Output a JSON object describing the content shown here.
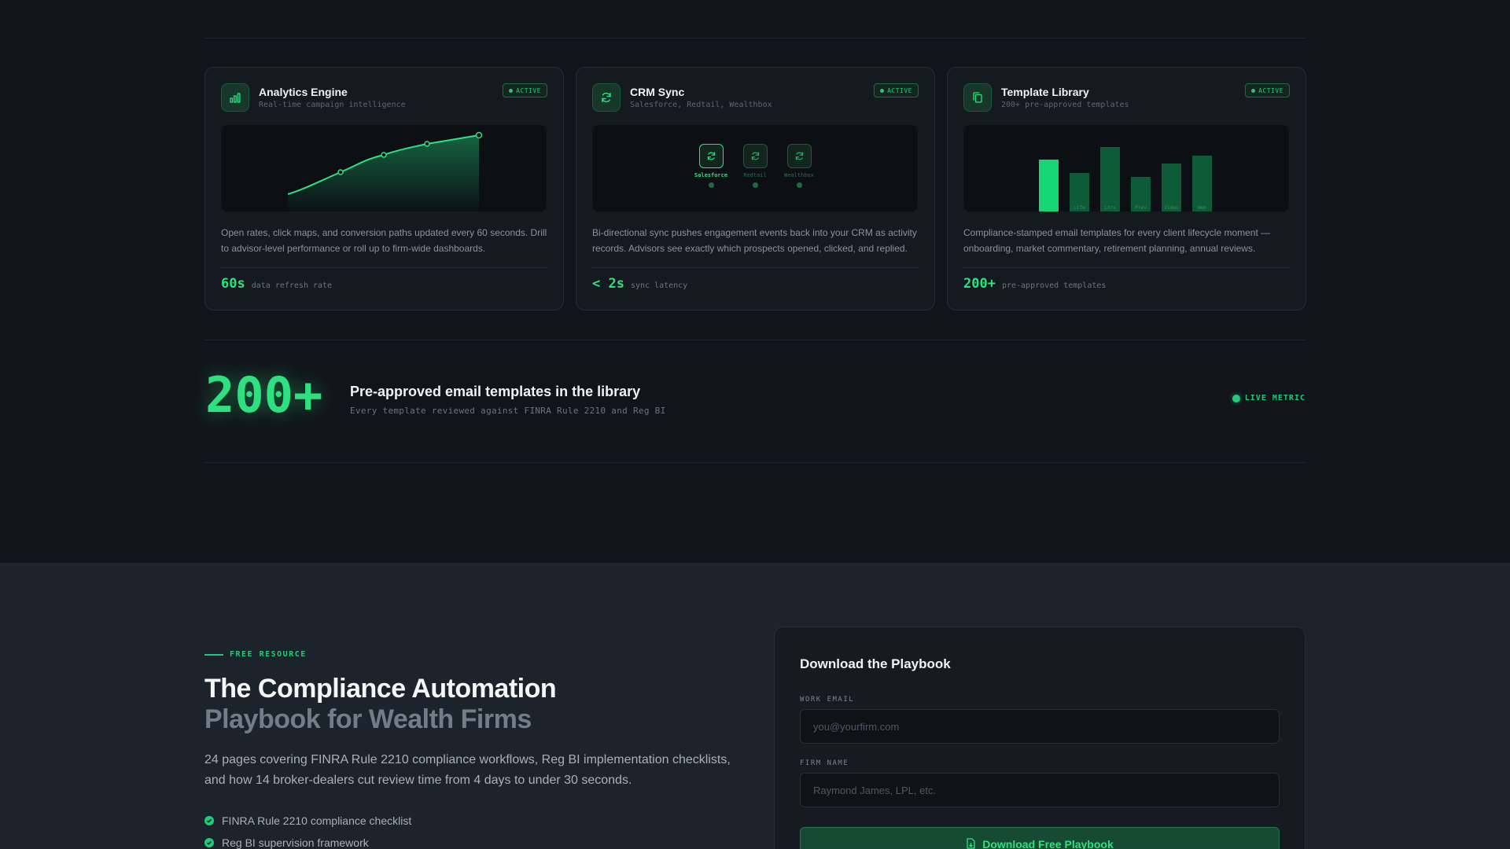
{
  "cards": [
    {
      "title": "Analytics Engine",
      "subtitle": "Real-time campaign intelligence",
      "badge": "ACTIVE",
      "icon": "bar-chart-icon",
      "description": "Open rates, click maps, and conversion paths updated every 60 seconds. Drill to advisor-level performance or roll up to firm-wide dashboards.",
      "stat_value": "60s",
      "stat_label": "data refresh rate"
    },
    {
      "title": "CRM Sync",
      "subtitle": "Salesforce, Redtail, Wealthbox",
      "badge": "ACTIVE",
      "icon": "refresh-icon",
      "description": "Bi-directional sync pushes engagement events back into your CRM as activity records. Advisors see exactly which prospects opened, clicked, and replied.",
      "stat_value": "< 2s",
      "stat_label": "sync latency",
      "integrations": [
        "Salesforce",
        "Redtail",
        "Wealthbox"
      ]
    },
    {
      "title": "Template Library",
      "subtitle": "200+ pre-approved templates",
      "badge": "ACTIVE",
      "icon": "copy-icon",
      "description": "Compliance-stamped email templates for every client lifecycle moment — onboarding, market commentary, retirement planning, annual reviews.",
      "stat_value": "200+",
      "stat_label": "pre-approved templates",
      "bar_labels": [
        "",
        "Life",
        "Ltrs",
        "Prev",
        "Video",
        "Web"
      ]
    }
  ],
  "metric": {
    "value": "200+",
    "title": "Pre-approved email templates in the library",
    "subtitle": "Every template reviewed against FINRA Rule 2210 and Reg BI",
    "live_label": "LIVE METRIC"
  },
  "resource": {
    "eyebrow": "FREE RESOURCE",
    "title_line1": "The Compliance Automation",
    "title_line2": "Playbook for Wealth Firms",
    "lead": "24 pages covering FINRA Rule 2210 compliance workflows, Reg BI implementation checklists, and how 14 broker-dealers cut review time from 4 days to under 30 seconds.",
    "checklist": [
      "FINRA Rule 2210 compliance checklist",
      "Reg BI supervision framework"
    ]
  },
  "form": {
    "title": "Download the Playbook",
    "email_label": "WORK EMAIL",
    "email_placeholder": "you@yourfirm.com",
    "firm_label": "FIRM NAME",
    "firm_placeholder": "Raymond James, LPL, etc.",
    "submit_label": "Download Free Playbook"
  },
  "colors": {
    "accent": "#2ee07f",
    "background": "#11151b",
    "card": "#151a20"
  }
}
